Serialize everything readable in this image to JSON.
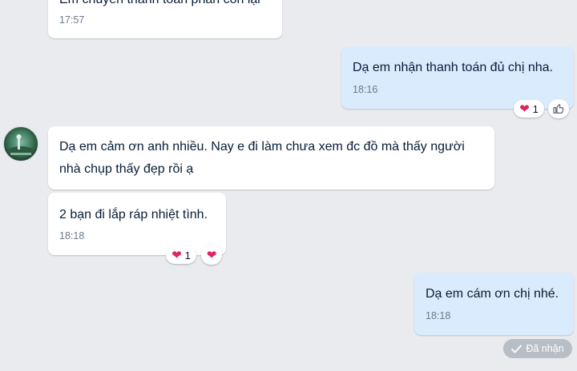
{
  "messages": [
    {
      "id": "m1",
      "text": "Em chuyển thanh toán phần còn lại",
      "time": "17:57"
    },
    {
      "id": "m2",
      "text": "Dạ em nhận thanh toán đủ chị nha.",
      "time": "18:16",
      "reaction_count": "1"
    },
    {
      "id": "m3",
      "text": "Dạ em cảm ơn anh nhiều. Nay e đi làm chưa xem đc đồ mà thấy người\nnhà chụp thấy đẹp rồi ạ"
    },
    {
      "id": "m4",
      "text": "2 bạn đi lắp ráp nhiệt tình.",
      "time": "18:18",
      "reaction_count": "1"
    },
    {
      "id": "m5",
      "text": "Dạ em cám ơn chị nhé.",
      "time": "18:18"
    }
  ],
  "status": {
    "label": "Đã nhận"
  },
  "icons": {
    "reaction": "heart-icon",
    "like": "thumbs-up-icon",
    "status": "check-icon"
  },
  "colors": {
    "incoming_bubble": "#ffffff",
    "outgoing_bubble": "#dbebfe",
    "background": "#e9ebee",
    "heart": "#e0245e"
  }
}
